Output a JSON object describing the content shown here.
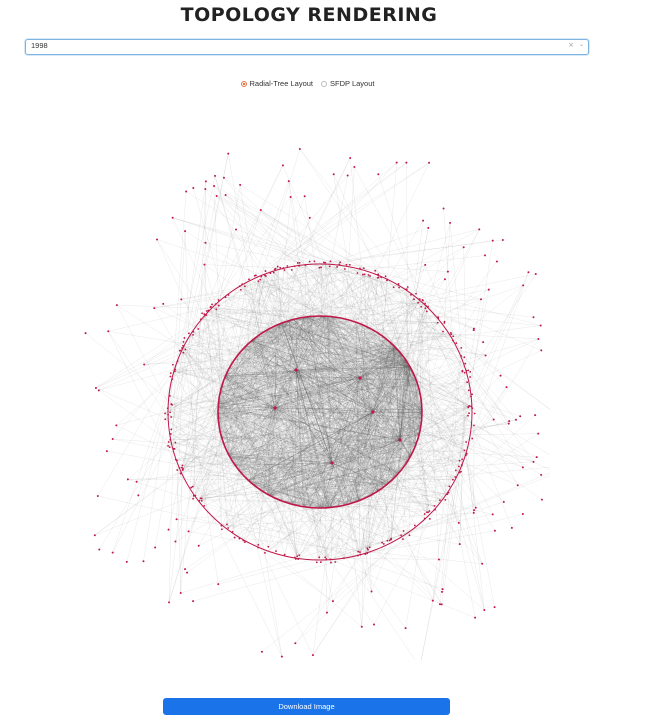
{
  "header": {
    "title": "TOPOLOGY RENDERING"
  },
  "year_select": {
    "value": "1998",
    "clear_icon": "×",
    "chevron_icon": "⌄"
  },
  "layout_options": [
    {
      "label": "Radial-Tree Layout",
      "selected": true
    },
    {
      "label": "SFDP Layout",
      "selected": false
    }
  ],
  "colors": {
    "node": "#c0184a",
    "edge": "#555555",
    "accent": "#1a73e8",
    "radio": "#e8774a"
  },
  "download_button": {
    "label": "Download Image"
  }
}
